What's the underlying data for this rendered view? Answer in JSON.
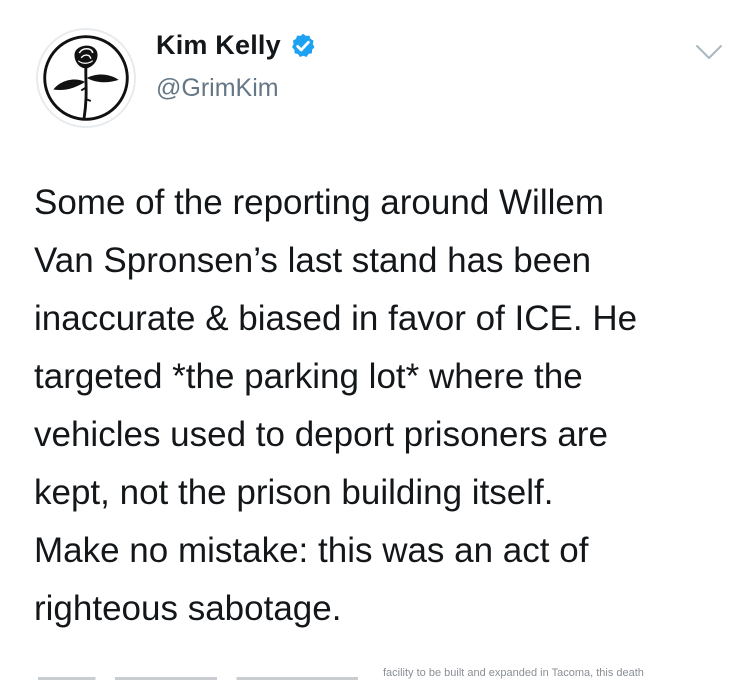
{
  "user": {
    "display_name": "Kim Kelly",
    "handle": "@GrimKim",
    "verified": true,
    "verified_color": "#1da1f2",
    "avatar_icon": "rose-icon"
  },
  "tweet": {
    "lines": [
      "Some of the reporting around Willem",
      "Van Spronsen’s last stand has been",
      "inaccurate & biased in favor of ICE. He",
      "targeted *the parking lot* where the",
      "vehicles used to deport prisoners are",
      "kept, not the prison building itself.",
      "Make no mistake: this was an act of",
      "righteous sabotage."
    ]
  },
  "card_preview": {
    "caption": "facility to be built and expanded in Tacoma, this death"
  },
  "colors": {
    "text": "#14171a",
    "secondary": "#657786",
    "chevron": "#aab8c2"
  },
  "icons": {
    "verified": "verified-badge-icon",
    "menu": "chevron-down-icon"
  }
}
